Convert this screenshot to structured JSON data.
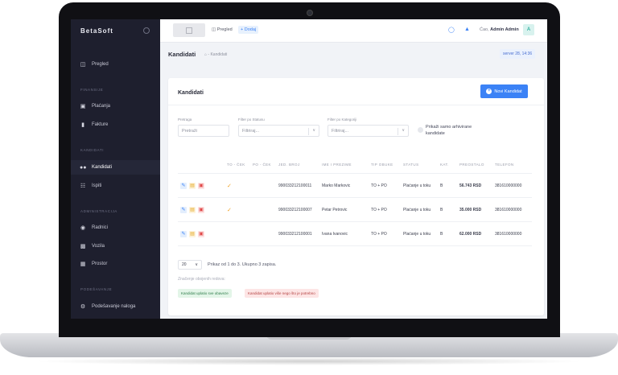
{
  "app": {
    "brand": "BetaSoft"
  },
  "sidebar": {
    "top_item": {
      "label": "Pregled",
      "icon": "database-icon"
    },
    "sections": [
      {
        "title": "FINANSIJE",
        "items": [
          {
            "label": "Plaćanja",
            "icon": "money-icon"
          },
          {
            "label": "Fakture",
            "icon": "invoice-icon"
          }
        ]
      },
      {
        "title": "KANDIDATI",
        "items": [
          {
            "label": "Kandidati",
            "icon": "users-icon",
            "active": true
          },
          {
            "label": "Ispiti",
            "icon": "exam-icon"
          }
        ]
      },
      {
        "title": "ADMINISTRACIJA",
        "items": [
          {
            "label": "Radnici",
            "icon": "workers-icon"
          },
          {
            "label": "Vozila",
            "icon": "car-icon"
          },
          {
            "label": "Prostor",
            "icon": "building-icon"
          }
        ]
      },
      {
        "title": "PODEŠAVANJE",
        "items": [
          {
            "label": "Podešavanje naloga",
            "icon": "gear-icon"
          }
        ]
      }
    ]
  },
  "topbar": {
    "pregled_label": "Pregled",
    "dodaj_label": "Dodaj",
    "greeting": "Ćao,",
    "user_name": "Admin Admin",
    "avatar_letter": "A"
  },
  "header": {
    "title": "Kandidati",
    "breadcrumb": "- Kandidati",
    "date": "server 28, 14:36"
  },
  "card": {
    "title": "Kandidati",
    "new_button": "Novi Kandidat"
  },
  "filters": {
    "search_label": "Pretraga",
    "search_placeholder": "Pretraži",
    "status_label": "Filter po Statusu",
    "status_value": "Filtriraj...",
    "category_label": "Filter po Kategoriji",
    "category_value": "Filtriraj...",
    "archived_label": "Prikaži samo arhivirane kandidate"
  },
  "table": {
    "headers": [
      "",
      "TO - ČEK",
      "PO - ČEK",
      "JED. BROJ",
      "IME I PREZIME",
      "TIP OBUKE",
      "STATUS",
      "KAT.",
      "PREOSTALO",
      "TELEFON"
    ],
    "rows": [
      {
        "to": true,
        "po": false,
        "jmbg": "990033212100011",
        "name": "Marko Markovic",
        "tip": "TO + PO",
        "status": "Plaćanje u toku",
        "kat": "B",
        "preostalo": "56.743 RSD",
        "telefon": "381610000000"
      },
      {
        "to": true,
        "po": false,
        "jmbg": "990033212100007",
        "name": "Petar Petrovic",
        "tip": "TO + PO",
        "status": "Plaćanje u toku",
        "kat": "B",
        "preostalo": "35.000 RSD",
        "telefon": "381610000000"
      },
      {
        "to": false,
        "po": false,
        "jmbg": "990033212100001",
        "name": "Ivana Ivanovic",
        "tip": "TO + PO",
        "status": "Plaćanje u toku",
        "kat": "B",
        "preostalo": "62.000 RSD",
        "telefon": "381610000000"
      }
    ]
  },
  "pagination": {
    "page_size": "20",
    "info": "Prikaz od 1 do 3. Ukupno 3 zapisa."
  },
  "legend": {
    "title": "Značenje obojenih redova:",
    "green": "Kandidat uplatio sve obaveze",
    "red": "Kandidat uplatio više nego što je potrebno"
  }
}
